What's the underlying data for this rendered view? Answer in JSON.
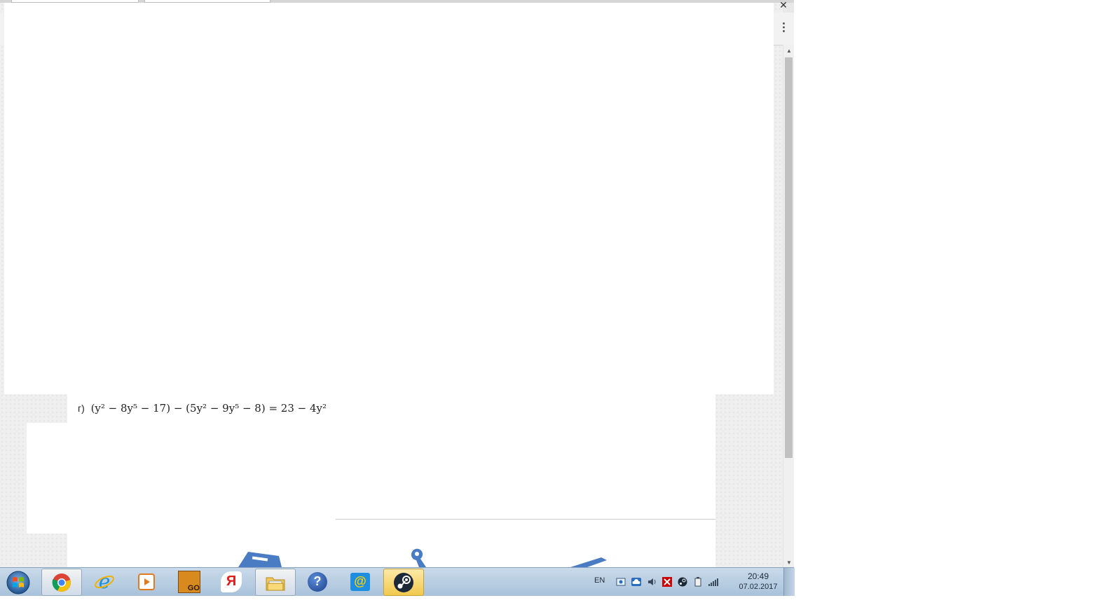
{
  "browser": {
    "close_glyph": "✕",
    "menu_glyph": "⋮"
  },
  "page": {
    "problem_label": "г)",
    "problem_equation": "(y² − 8y⁵ − 17) − (5y² − 9y⁵ − 8) = 23 − 4y²"
  },
  "scrollbar": {
    "up_glyph": "▲",
    "down_glyph": "▼"
  },
  "taskbar": {
    "items": [
      {
        "name": "chrome-icon"
      },
      {
        "name": "internet-explorer-icon"
      },
      {
        "name": "media-player-icon"
      },
      {
        "name": "csgo-icon",
        "text": "GO"
      },
      {
        "name": "yandex-icon",
        "text": "Я"
      },
      {
        "name": "file-explorer-icon"
      },
      {
        "name": "help-icon",
        "text": "?"
      },
      {
        "name": "mail-agent-icon",
        "text": "@"
      },
      {
        "name": "steam-icon"
      }
    ],
    "language": "EN",
    "clock_time": "20:49",
    "clock_date": "07.02.2017"
  },
  "colors": {
    "taskbar_top": "#c9daea",
    "taskbar_bottom": "#a9c2da",
    "accent_blue": "#3d6fb6",
    "page_background": "#efefef"
  }
}
